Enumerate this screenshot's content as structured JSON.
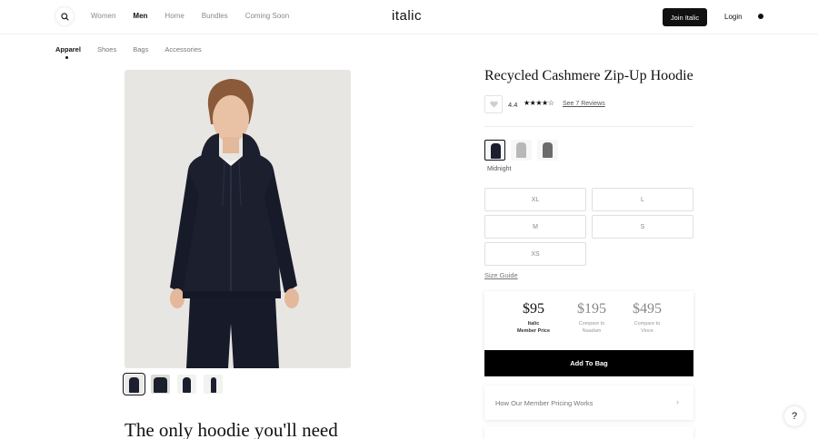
{
  "header": {
    "nav": [
      "Women",
      "Men",
      "Home",
      "Bundles",
      "Coming Soon"
    ],
    "active_nav": "Men",
    "logo": "italic",
    "join_label": "Join Italic",
    "login_label": "Login"
  },
  "subnav": {
    "items": [
      "Apparel",
      "Shoes",
      "Bags",
      "Accessories"
    ],
    "active": "Apparel"
  },
  "product": {
    "title": "Recycled Cashmere Zip-Up Hoodie",
    "rating": "4.4",
    "stars_filled": 4,
    "stars_total": 5,
    "reviews_link": "See 7 Reviews",
    "selected_color": "Midnight",
    "colors": [
      {
        "name": "Midnight",
        "hex": "#1b1f2e"
      },
      {
        "name": "Heather Grey",
        "hex": "#b8b8b8"
      },
      {
        "name": "Charcoal",
        "hex": "#6b6b6b"
      }
    ],
    "sizes": [
      "XL",
      "L",
      "M",
      "S",
      "XS"
    ],
    "size_guide": "Size Guide",
    "prices": [
      {
        "amount": "$95",
        "line1": "Italic",
        "line2": "Member Price"
      },
      {
        "amount": "$195",
        "line1": "Compare to",
        "line2": "Naadam"
      },
      {
        "amount": "$495",
        "line1": "Compare to",
        "line2": "Vince"
      }
    ],
    "add_to_bag": "Add To Bag",
    "pricing_works": "How Our Member Pricing Works",
    "headline": "The only hoodie you'll need"
  },
  "help_label": "?",
  "colors": {
    "accent": "#000000",
    "garment": "#1b1f2e",
    "image_bg": "#e7e6e2"
  }
}
